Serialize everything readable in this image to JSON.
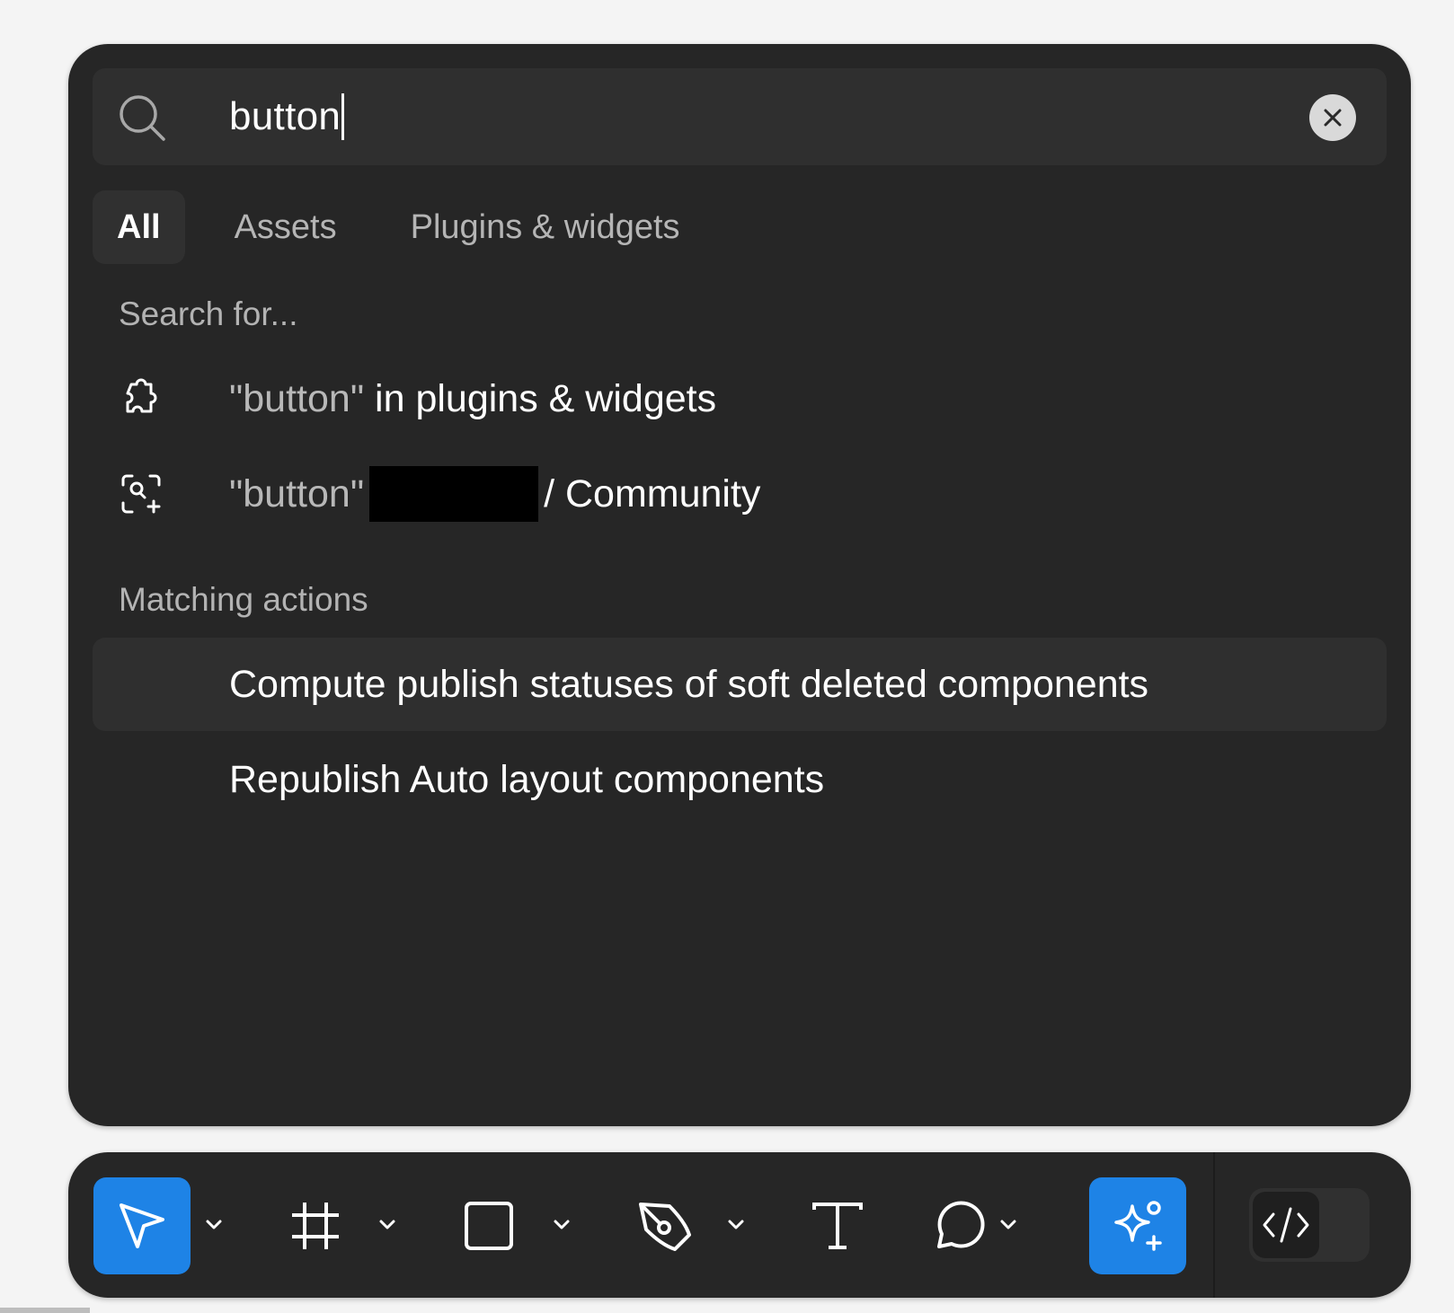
{
  "search": {
    "value": "button",
    "clear_label": "Clear search"
  },
  "tabs": [
    {
      "label": "All",
      "active": true
    },
    {
      "label": "Assets",
      "active": false
    },
    {
      "label": "Plugins & widgets",
      "active": false
    }
  ],
  "search_for": {
    "title": "Search for...",
    "items": [
      {
        "icon": "puzzle-icon",
        "query": "\"button\"",
        "suffix": " in plugins & widgets"
      },
      {
        "icon": "community-search-icon",
        "query": "\"button\"",
        "suffix": "/ Community"
      }
    ]
  },
  "matching_actions": {
    "title": "Matching actions",
    "items": [
      {
        "label": "Compute publish statuses of soft deleted components",
        "highlighted": true
      },
      {
        "label": "Republish Auto layout components",
        "highlighted": false
      }
    ]
  },
  "toolbar": {
    "tools": [
      {
        "icon": "move-cursor-icon",
        "active": true
      },
      {
        "icon": "frame-icon",
        "active": false
      },
      {
        "icon": "rectangle-icon",
        "active": false
      },
      {
        "icon": "pen-icon",
        "active": false
      },
      {
        "icon": "text-icon",
        "active": false
      },
      {
        "icon": "comment-icon",
        "active": false
      },
      {
        "icon": "ai-sparkle-icon",
        "active": true
      }
    ],
    "dev_mode_icon": "code-icon"
  },
  "colors": {
    "panel_bg": "#262626",
    "accent": "#1e83e6",
    "text": "#ffffff",
    "muted": "#b3b3b3"
  }
}
